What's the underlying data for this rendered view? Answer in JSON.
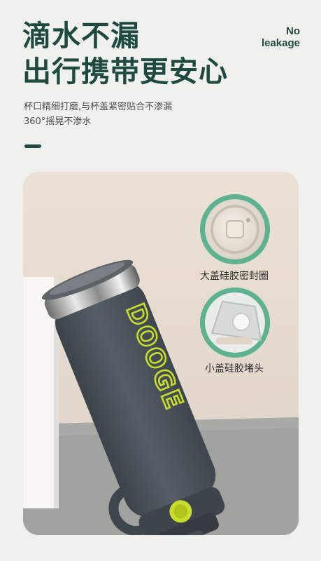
{
  "headline": {
    "line1": "滴水不漏",
    "line2": "出行携带更安心"
  },
  "badge_en": {
    "line1": "No",
    "line2": "leakage"
  },
  "subcopy": {
    "line1": "杯口精细打磨,与杯盖紧密贴合不渗漏",
    "line2": "360°摇晃不渗水"
  },
  "product": {
    "brand_wordmark": "DOOGE"
  },
  "details": [
    {
      "label": "大盖硅胶密封圈"
    },
    {
      "label": "小盖硅胶堵头"
    }
  ],
  "colors": {
    "headline": "#1f4a40",
    "accent_lime": "#c8dc2c",
    "bottle_body": "#4c545d",
    "circle_bg": "#5fb28f",
    "scene_bg": "#e6dbd1"
  }
}
